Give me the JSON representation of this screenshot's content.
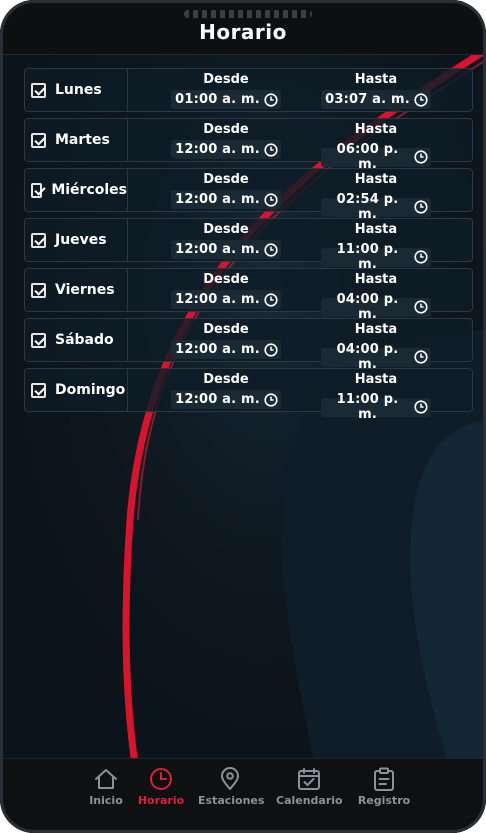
{
  "header": {
    "title": "Horario"
  },
  "columns": {
    "from_label": "Desde",
    "to_label": "Hasta"
  },
  "schedule": [
    {
      "day": "Lunes",
      "checked": true,
      "from": "01:00 a. m.",
      "to": "03:07 a. m."
    },
    {
      "day": "Martes",
      "checked": true,
      "from": "12:00 a. m.",
      "to": "06:00 p. m."
    },
    {
      "day": "Miércoles",
      "checked": true,
      "from": "12:00 a. m.",
      "to": "02:54 p. m."
    },
    {
      "day": "Jueves",
      "checked": true,
      "from": "12:00 a. m.",
      "to": "11:00 p. m."
    },
    {
      "day": "Viernes",
      "checked": true,
      "from": "12:00 a. m.",
      "to": "04:00 p. m."
    },
    {
      "day": "Sábado",
      "checked": true,
      "from": "12:00 a. m.",
      "to": "04:00 p. m."
    },
    {
      "day": "Domingo",
      "checked": true,
      "from": "12:00 a. m.",
      "to": "11:00 p. m."
    }
  ],
  "nav": [
    {
      "label": "Inicio",
      "icon": "home-icon",
      "active": false
    },
    {
      "label": "Horario",
      "icon": "clock-icon",
      "active": true
    },
    {
      "label": "Estaciones",
      "icon": "map-pin-icon",
      "active": false
    },
    {
      "label": "Calendario",
      "icon": "calendar-check-icon",
      "active": false
    },
    {
      "label": "Registro",
      "icon": "clipboard-icon",
      "active": false
    }
  ],
  "colors": {
    "accent": "#d9213a",
    "background": "#0b1219",
    "inactive": "#8a9299"
  }
}
